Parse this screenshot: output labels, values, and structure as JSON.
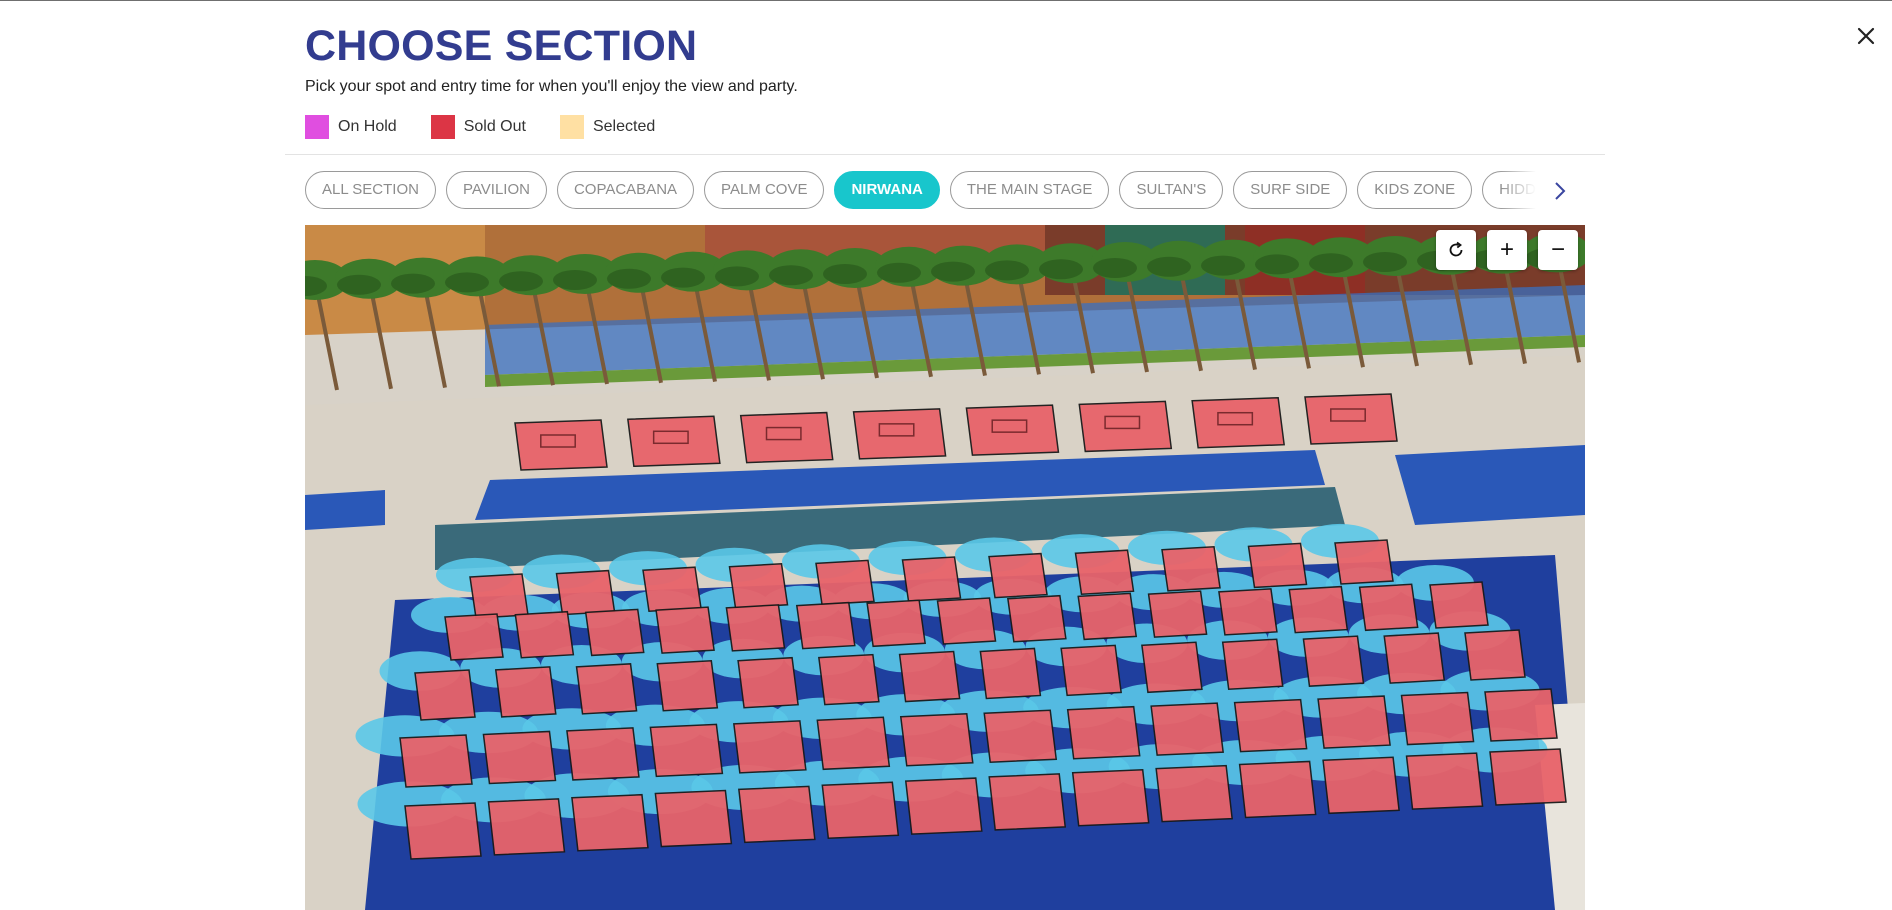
{
  "dialog": {
    "title": "CHOOSE SECTION",
    "subtitle": "Pick your spot and entry time for when you'll enjoy the view and party."
  },
  "legend": [
    {
      "label": "On Hold",
      "color": "#e04ee0"
    },
    {
      "label": "Sold Out",
      "color": "#dc3545"
    },
    {
      "label": "Selected",
      "color": "#ffe0a3"
    }
  ],
  "tabs": [
    {
      "label": "ALL SECTION",
      "active": false
    },
    {
      "label": "PAVILION",
      "active": false
    },
    {
      "label": "COPACABANA",
      "active": false
    },
    {
      "label": "PALM COVE",
      "active": false
    },
    {
      "label": "NIRWANA",
      "active": true
    },
    {
      "label": "THE MAIN STAGE",
      "active": false
    },
    {
      "label": "SULTAN'S",
      "active": false
    },
    {
      "label": "SURF SIDE",
      "active": false
    },
    {
      "label": "KIDS ZONE",
      "active": false
    },
    {
      "label": "HIDDEN",
      "active": false
    }
  ],
  "map": {
    "controls": {
      "reset_icon": "refresh-icon",
      "zoom_in": "+",
      "zoom_out": "−"
    },
    "spot_status": "Sold Out",
    "spot_color": "#e8636a",
    "colors": {
      "deep_pool": "#1f3f9e",
      "water": "#2a58b8",
      "deck": "#d9d2c6",
      "umbrella": "#5ac8e8"
    }
  },
  "icons": {
    "close": "close-icon",
    "next": "chevron-right-icon"
  }
}
